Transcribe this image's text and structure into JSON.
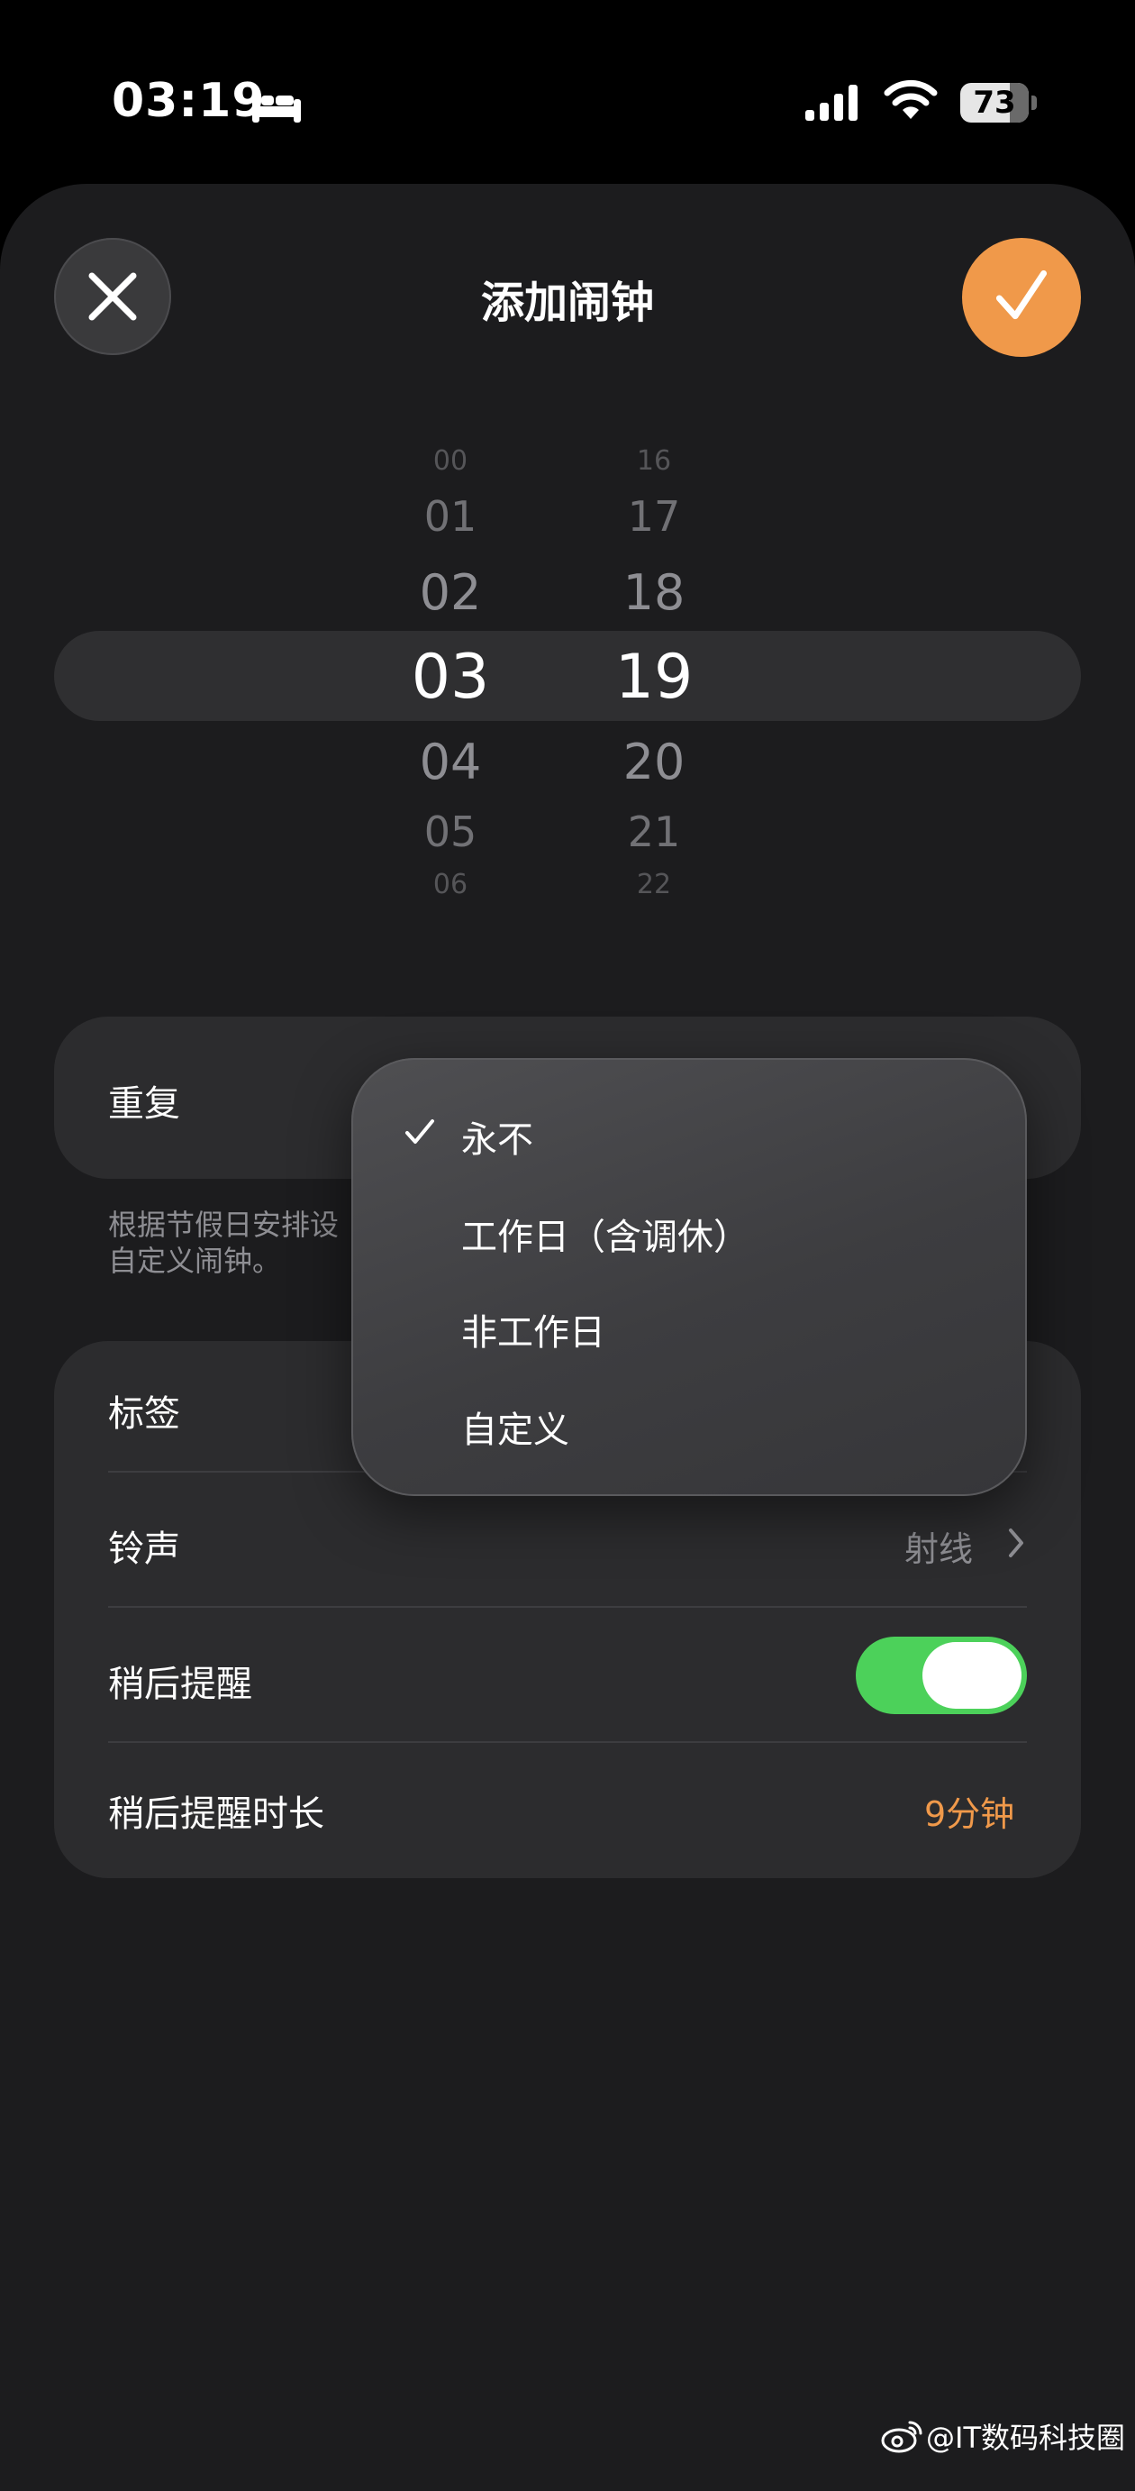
{
  "status_bar": {
    "time": "03:19",
    "focus_icon": "bed-icon",
    "battery_level": 73,
    "battery_text": "73"
  },
  "header": {
    "title": "添加闹钟",
    "close_icon": "close-icon",
    "confirm_icon": "checkmark-icon",
    "accent_color": "#f0994a"
  },
  "time_picker": {
    "hours": [
      "00",
      "01",
      "02",
      "03",
      "04",
      "05",
      "06"
    ],
    "minutes": [
      "16",
      "17",
      "18",
      "19",
      "20",
      "21",
      "22"
    ],
    "selected_hour": "03",
    "selected_minute": "19"
  },
  "repeat": {
    "label": "重复",
    "footnote_line1": "根据节假日安排设",
    "footnote_line2": "自定义闹钟。"
  },
  "repeat_menu": {
    "options": [
      "永不",
      "工作日（含调休）",
      "非工作日",
      "自定义"
    ],
    "selected_index": 0,
    "selected_icon": "check-icon"
  },
  "settings": {
    "label_row": {
      "label": "标签"
    },
    "sound_row": {
      "label": "铃声",
      "value": "射线"
    },
    "snooze_row": {
      "label": "稍后提醒",
      "toggle_on": true,
      "toggle_color": "#4cd15a"
    },
    "snooze_duration_row": {
      "label": "稍后提醒时长",
      "value": "9分钟",
      "value_color": "#f0994a"
    }
  },
  "watermark": {
    "icon": "weibo-icon",
    "text": "@IT数码科技圈"
  }
}
